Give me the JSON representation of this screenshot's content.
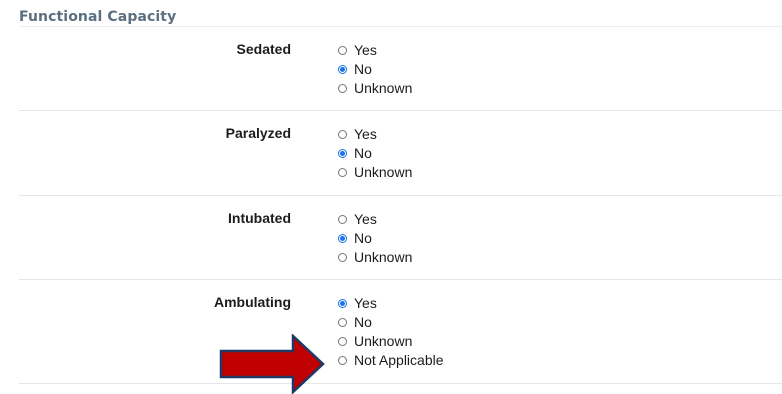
{
  "section": {
    "title": "Functional Capacity"
  },
  "fields": [
    {
      "label": "Sedated",
      "options": [
        {
          "label": "Yes",
          "checked": false
        },
        {
          "label": "No",
          "checked": true
        },
        {
          "label": "Unknown",
          "checked": false
        }
      ]
    },
    {
      "label": "Paralyzed",
      "options": [
        {
          "label": "Yes",
          "checked": false
        },
        {
          "label": "No",
          "checked": true
        },
        {
          "label": "Unknown",
          "checked": false
        }
      ]
    },
    {
      "label": "Intubated",
      "options": [
        {
          "label": "Yes",
          "checked": false
        },
        {
          "label": "No",
          "checked": true
        },
        {
          "label": "Unknown",
          "checked": false
        }
      ]
    },
    {
      "label": "Ambulating",
      "options": [
        {
          "label": "Yes",
          "checked": true
        },
        {
          "label": "No",
          "checked": false
        },
        {
          "label": "Unknown",
          "checked": false
        },
        {
          "label": "Not Applicable",
          "checked": false
        }
      ]
    }
  ],
  "colors": {
    "section_title": "#5b6f80",
    "radio_checked": "#1a73e8",
    "arrow_fill": "#c00000",
    "arrow_stroke": "#1f3864"
  },
  "annotation": {
    "icon": "red-arrow-right-icon"
  }
}
